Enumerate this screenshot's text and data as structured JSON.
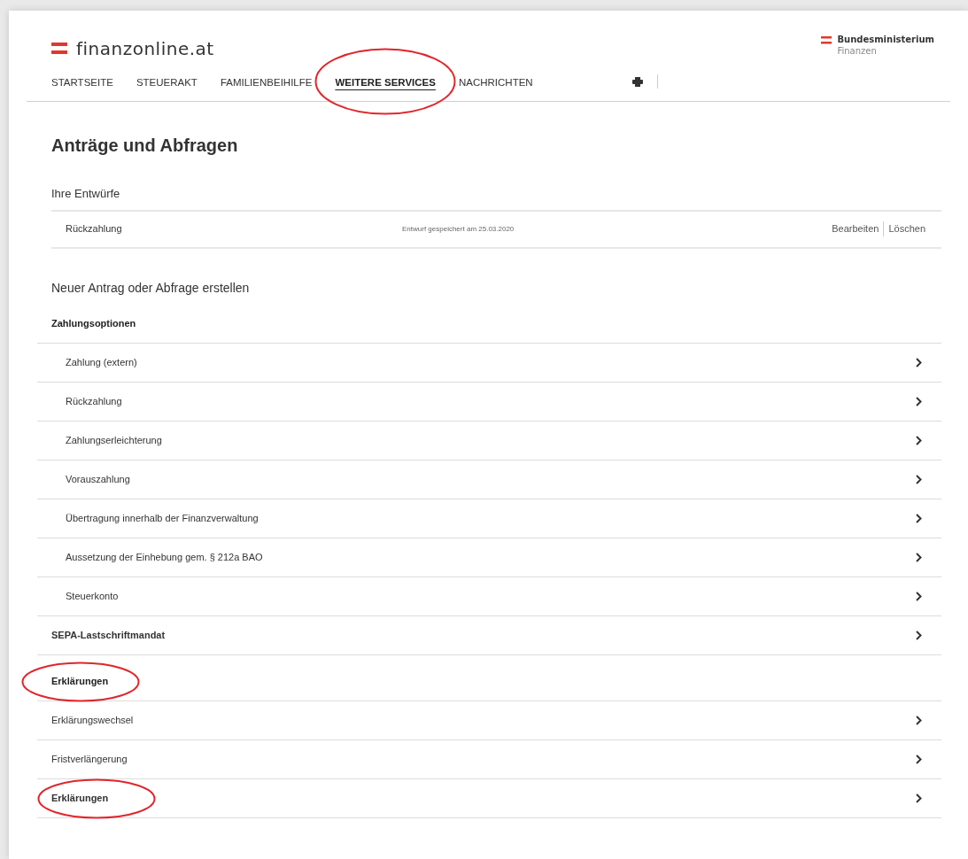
{
  "header": {
    "logo": "finanzonline.at",
    "ministry": "Bundesministerium",
    "ministry_sub": "Finanzen"
  },
  "nav": [
    {
      "label": "STARTSEITE",
      "selected": false,
      "highlighted": false
    },
    {
      "label": "STEUERAKT",
      "selected": false,
      "highlighted": false
    },
    {
      "label": "FAMILIENBEIHILFE",
      "selected": false,
      "highlighted": false
    },
    {
      "label": "WEITERE SERVICES",
      "selected": true,
      "highlighted": true
    },
    {
      "label": "NACHRICHTEN",
      "selected": false,
      "highlighted": false
    }
  ],
  "title": "Anträge und Abfragen",
  "drafts": {
    "heading": "Ihre Entwürfe",
    "items": [
      {
        "name": "Rückzahlung",
        "saved": "Entwurf gespeichert am 25.03.2020",
        "actions": [
          "Bearbeiten",
          "Löschen"
        ]
      }
    ]
  },
  "new_heading": "Neuer Antrag oder Abfrage erstellen",
  "rows": [
    {
      "kind": "heading",
      "label": "Zahlungsoptionen",
      "highlighted": false
    },
    {
      "kind": "subitem",
      "label": "Zahlung (extern)",
      "highlighted": false
    },
    {
      "kind": "subitem",
      "label": "Rückzahlung",
      "highlighted": false
    },
    {
      "kind": "subitem",
      "label": "Zahlungserleichterung",
      "highlighted": false
    },
    {
      "kind": "subitem",
      "label": "Vorauszahlung",
      "highlighted": false
    },
    {
      "kind": "subitem",
      "label": "Übertragung innerhalb der Finanzverwaltung",
      "highlighted": false
    },
    {
      "kind": "subitem",
      "label": "Aussetzung der Einhebung gem. § 212a BAO",
      "highlighted": false
    },
    {
      "kind": "subitem",
      "label": "Steuerkonto",
      "highlighted": false
    },
    {
      "kind": "group",
      "label": "SEPA-Lastschriftmandat",
      "highlighted": false
    },
    {
      "kind": "heading",
      "label": "Erklärungen",
      "highlighted": true
    },
    {
      "kind": "item",
      "label": "Erklärungswechsel",
      "highlighted": false
    },
    {
      "kind": "item",
      "label": "Fristverlängerung",
      "highlighted": false
    },
    {
      "kind": "group",
      "label": "Erklärungen",
      "highlighted": true
    }
  ]
}
